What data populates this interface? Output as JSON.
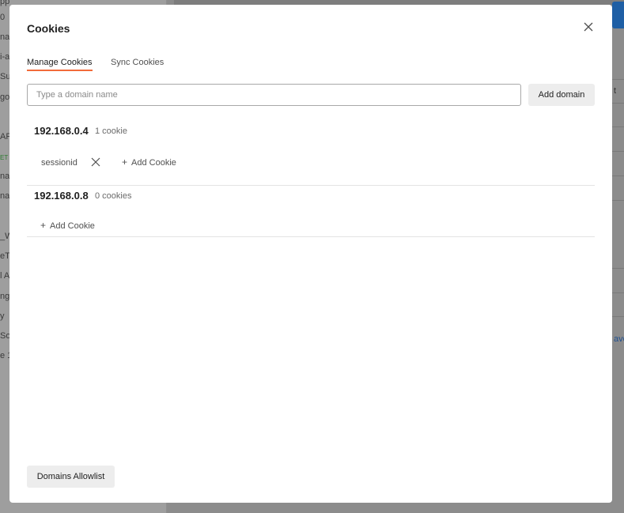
{
  "background": {
    "sidebar_fragments": [
      "pp",
      "0",
      "nar",
      "i-a",
      "Su",
      "go",
      "AP",
      "ET",
      "nar",
      "nar",
      "_W",
      "eTe",
      "l A",
      "ng",
      "y",
      "So",
      "e 1"
    ],
    "right_fragments": {
      "header_t": "t",
      "link_save": "ave"
    }
  },
  "modal": {
    "title": "Cookies",
    "close_icon": "close-icon",
    "tabs": [
      {
        "label": "Manage Cookies",
        "active": true
      },
      {
        "label": "Sync Cookies",
        "active": false
      }
    ],
    "domain_input": {
      "value": "",
      "placeholder": "Type a domain name"
    },
    "add_domain_label": "Add domain",
    "domains": [
      {
        "name": "192.168.0.4",
        "count_label": "1 cookie",
        "cookies": [
          {
            "name": "sessionid"
          }
        ],
        "add_cookie_label": "Add Cookie"
      },
      {
        "name": "192.168.0.8",
        "count_label": "0 cookies",
        "cookies": [],
        "add_cookie_label": "Add Cookie"
      }
    ],
    "allowlist_label": "Domains Allowlist"
  },
  "colors": {
    "accent_tab_underline": "#f26b3a",
    "overlay": "#8a8a8a",
    "primary_blue": "#1f5fa5"
  }
}
